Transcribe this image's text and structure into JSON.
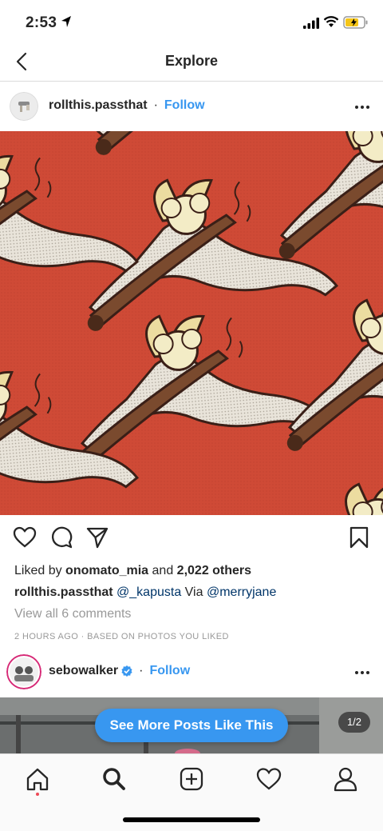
{
  "status_bar": {
    "time": "2:53"
  },
  "nav": {
    "title": "Explore"
  },
  "post1": {
    "username": "rollthis.passthat",
    "dot": "·",
    "follow": "Follow",
    "liked_prefix": "Liked by",
    "liked_user": "onomato_mia",
    "liked_and": "and",
    "liked_others": "2,022 others",
    "caption_user": "rollthis.passthat",
    "caption_mention1": "@_kapusta",
    "caption_via": "Via",
    "caption_mention2": "@merryjane",
    "view_comments": "View all 6 comments",
    "meta": "2 HOURS AGO · BASED ON PHOTOS YOU LIKED"
  },
  "post2": {
    "username": "sebowalker",
    "dot": "·",
    "follow": "Follow",
    "see_more": "See More Posts Like This",
    "counter": "1/2"
  },
  "colors": {
    "accent": "#3897f0",
    "notification": "#ed4956",
    "image_bg": "#cf4a36"
  },
  "icons": {
    "status": [
      "location-arrow-icon",
      "signal-icon",
      "wifi-icon",
      "battery-icon"
    ],
    "actions": [
      "heart-icon",
      "comment-icon",
      "share-icon",
      "bookmark-icon"
    ],
    "tabs": [
      "home-icon",
      "search-icon",
      "add-icon",
      "activity-icon",
      "profile-icon"
    ]
  }
}
